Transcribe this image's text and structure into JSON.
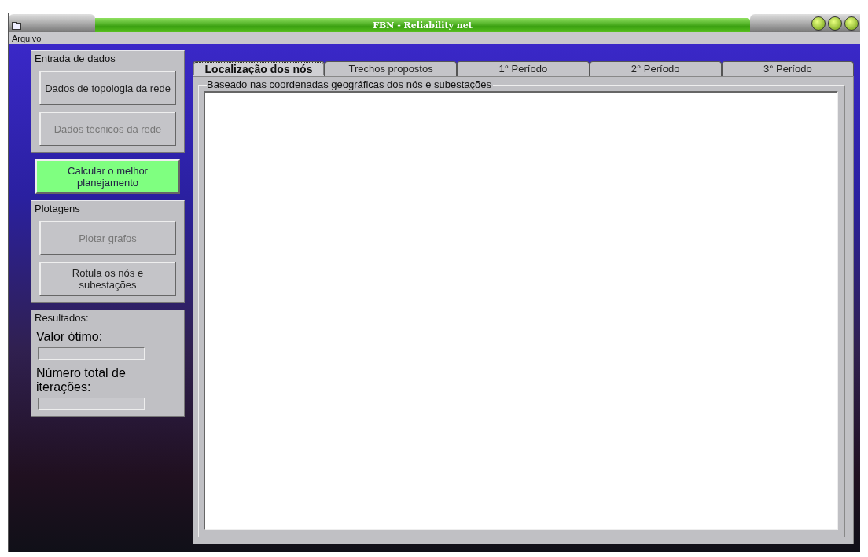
{
  "window": {
    "title": "FBN - Reliability net"
  },
  "menu": [
    "Arquivo"
  ],
  "sidebar": [
    {
      "kind": "group",
      "title": "Entrada de dados",
      "items": [
        {
          "kind": "button",
          "label": "Dados de topologia da rede",
          "disabled": false
        },
        {
          "kind": "button",
          "label": "Dados técnicos da rede",
          "disabled": true
        }
      ]
    },
    {
      "kind": "action",
      "label": "Calcular o melhor planejamento",
      "disabled": false
    },
    {
      "kind": "group",
      "title": "Plotagens",
      "items": [
        {
          "kind": "button",
          "label": "Plotar grafos",
          "disabled": true
        },
        {
          "kind": "button",
          "label": "Rotula os nós e subestações",
          "disabled": false
        }
      ]
    },
    {
      "kind": "group",
      "title": "Resultados:",
      "items": [
        {
          "kind": "label",
          "label": "Valor ótimo:"
        },
        {
          "kind": "field"
        },
        {
          "kind": "label",
          "label": "Número total de iterações:"
        },
        {
          "kind": "field"
        }
      ]
    }
  ],
  "tabs": [
    {
      "label": "Localização dos nós",
      "selected": true
    },
    {
      "label": "Trechos propostos",
      "selected": false
    },
    {
      "label": "1° Período",
      "selected": false
    },
    {
      "label": "2° Período",
      "selected": false
    },
    {
      "label": "3° Período",
      "selected": false
    }
  ],
  "panel": {
    "title": "Baseado nas coordenadas geográficas dos nós e subestações"
  }
}
